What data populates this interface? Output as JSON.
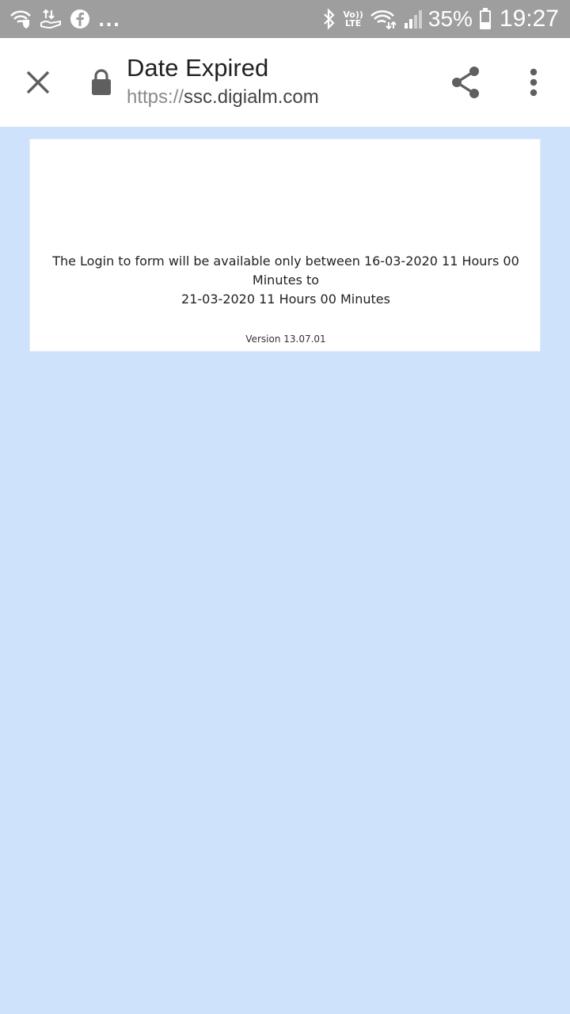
{
  "status_bar": {
    "left_icons": [
      "wifi-shield-icon",
      "data-transfer-icon",
      "facebook-icon"
    ],
    "more_notifications": "...",
    "right_icons": [
      "bluetooth-icon",
      "volte-icon",
      "wifi-icon",
      "signal-icon",
      "battery-icon"
    ],
    "volte_top": "Vo))",
    "volte_bottom": "LTE",
    "battery_percent": "35%",
    "time": "19:27"
  },
  "toolbar": {
    "title": "Date Expired",
    "url_scheme": "https://",
    "url_host": "ssc.digialm.com"
  },
  "page": {
    "message_line1": "The Login to form will be available only between 16-03-2020 11 Hours 00 Minutes to",
    "message_line2": "21-03-2020 11 Hours 00 Minutes",
    "version": "Version 13.07.01"
  },
  "colors": {
    "status_bar_bg": "#9e9e9e",
    "page_bg": "#cfe2fb",
    "toolbar_bg": "#ffffff"
  }
}
